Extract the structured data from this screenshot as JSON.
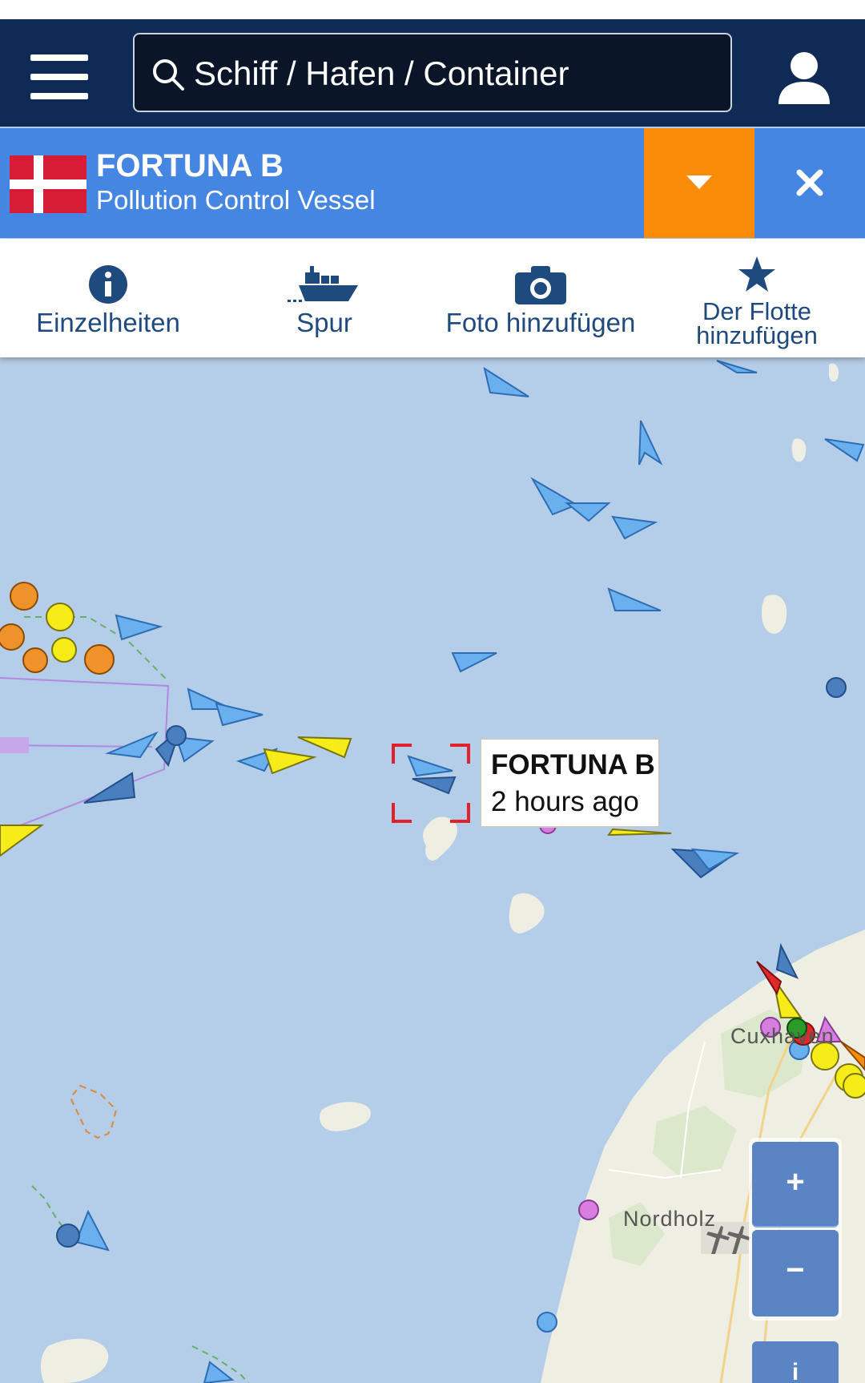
{
  "search": {
    "placeholder": "Schiff / Hafen / Container"
  },
  "vessel": {
    "name": "FORTUNA B",
    "type": "Pollution Control Vessel",
    "flag_icon": "denmark-flag-icon",
    "bar_color": "#4586e3",
    "dropdown_color": "#fa8c0a"
  },
  "actions": [
    {
      "label": "Einzelheiten",
      "icon": "info-icon"
    },
    {
      "label": "Spur",
      "icon": "ship-track-icon"
    },
    {
      "label": "Foto hinzufügen",
      "icon": "camera-icon"
    },
    {
      "label_line1": "Der Flotte",
      "label_line2": "hinzufügen",
      "icon": "star-icon"
    }
  ],
  "map": {
    "tooltip": {
      "name": "FORTUNA B",
      "time": "2 hours ago"
    },
    "places": [
      "Cuxhaven",
      "Nordholz"
    ],
    "zoom_in_label": "+",
    "zoom_out_label": "−",
    "info_label": "i"
  },
  "colors": {
    "header": "#0f2a55",
    "sea": "#b4cde8",
    "tanker_marker": "#f5ec1a",
    "cargo_marker": "#6ab0ef",
    "selection": "#e0202a"
  }
}
